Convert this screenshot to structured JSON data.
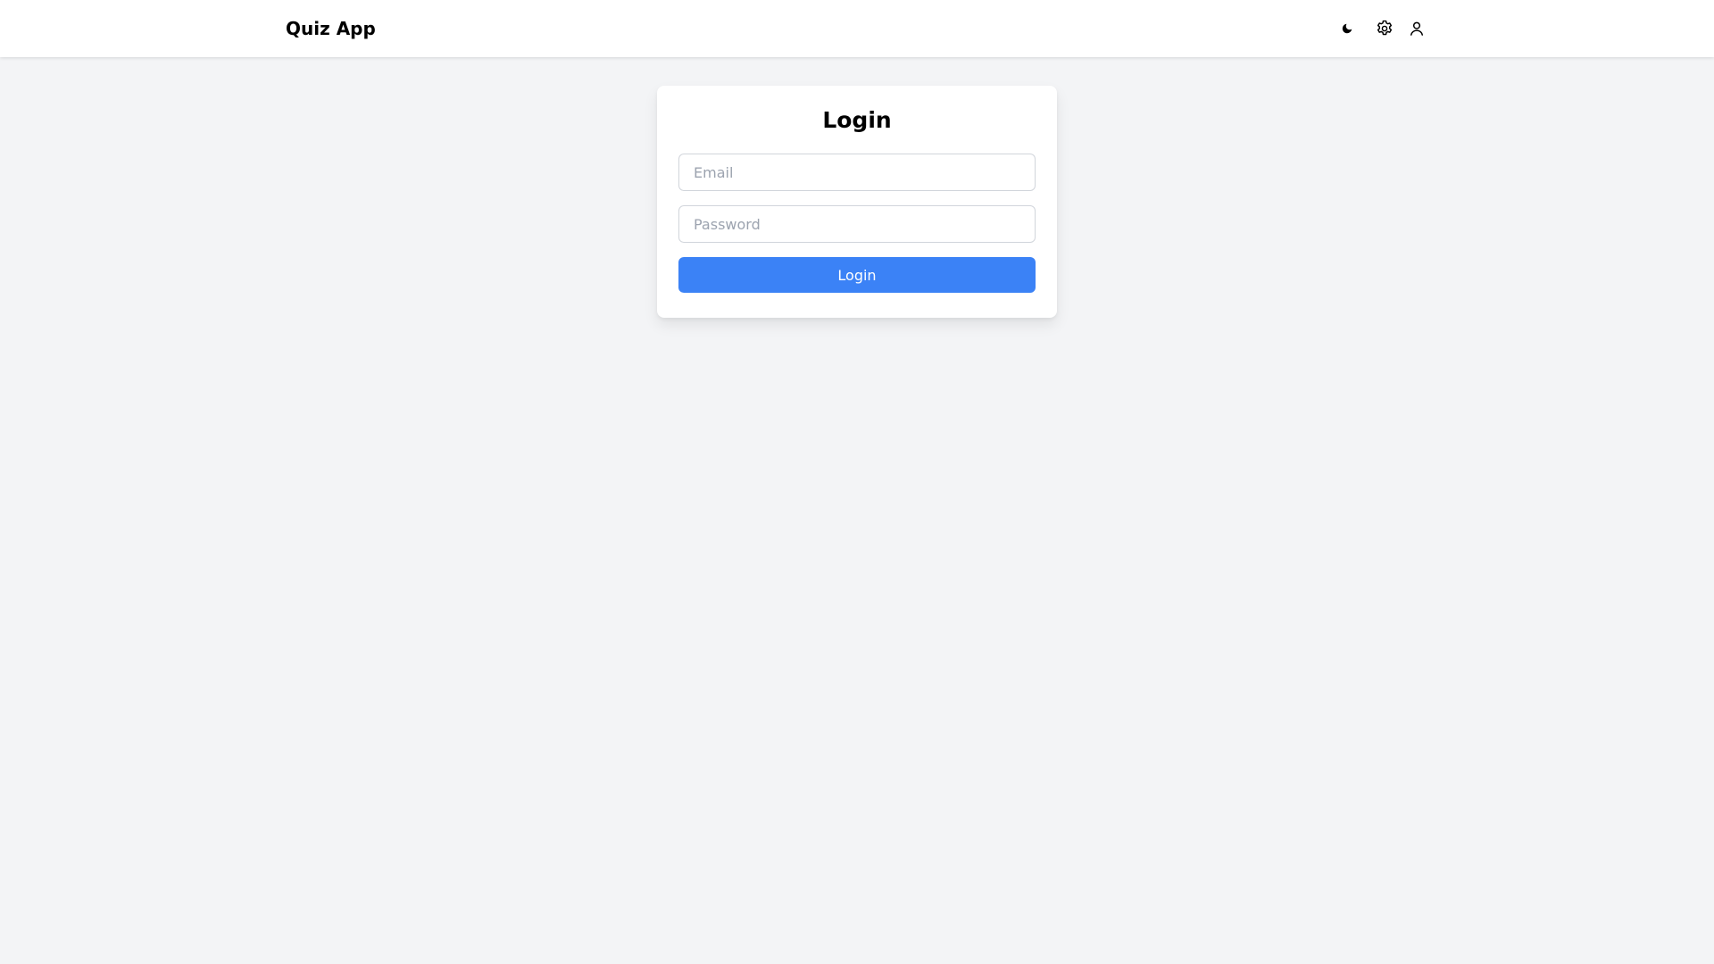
{
  "header": {
    "brand": "Quiz App",
    "icons": [
      "moon-icon",
      "gear-icon",
      "user-icon"
    ]
  },
  "login": {
    "title": "Login",
    "email": {
      "value": "",
      "placeholder": "Email"
    },
    "password": {
      "value": "",
      "placeholder": "Password"
    },
    "submit_label": "Login"
  },
  "colors": {
    "background": "#f3f4f6",
    "accent": "#3b82f6",
    "border": "#d1d5db",
    "placeholder": "#9ca3af"
  }
}
